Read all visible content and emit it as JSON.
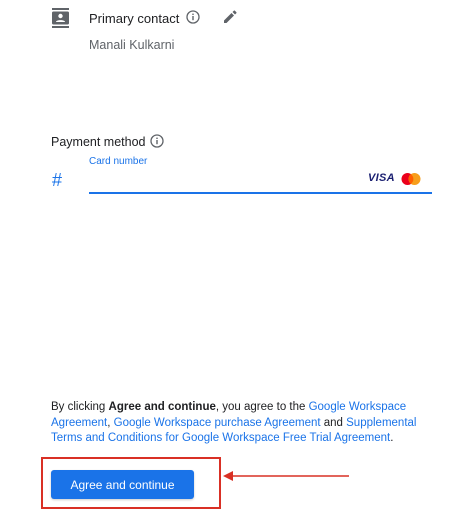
{
  "contact": {
    "title": "Primary contact",
    "name": "Manali Kulkarni",
    "icons": [
      "contact-card-icon",
      "info-icon",
      "edit-icon"
    ]
  },
  "payment": {
    "title": "Payment method",
    "card_field_label": "Card number",
    "card_brands": [
      "VISA",
      "Mastercard"
    ],
    "prefix_icon": "#"
  },
  "agreement": {
    "prefix": "By clicking ",
    "bold": "Agree and continue",
    "middle1": ", you agree to the ",
    "link1": "Google Workspace Agreement",
    "sep1": ", ",
    "link2": "Google Workspace purchase Agreement",
    "sep2": " and ",
    "link3": "Supplemental Terms and Conditions for Google Workspace Free Trial Agreement",
    "end": "."
  },
  "button": {
    "label": "Agree and continue"
  },
  "colors": {
    "accent": "#1a73e8",
    "highlight": "#d93025",
    "text": "#202124",
    "muted": "#5f6368"
  }
}
